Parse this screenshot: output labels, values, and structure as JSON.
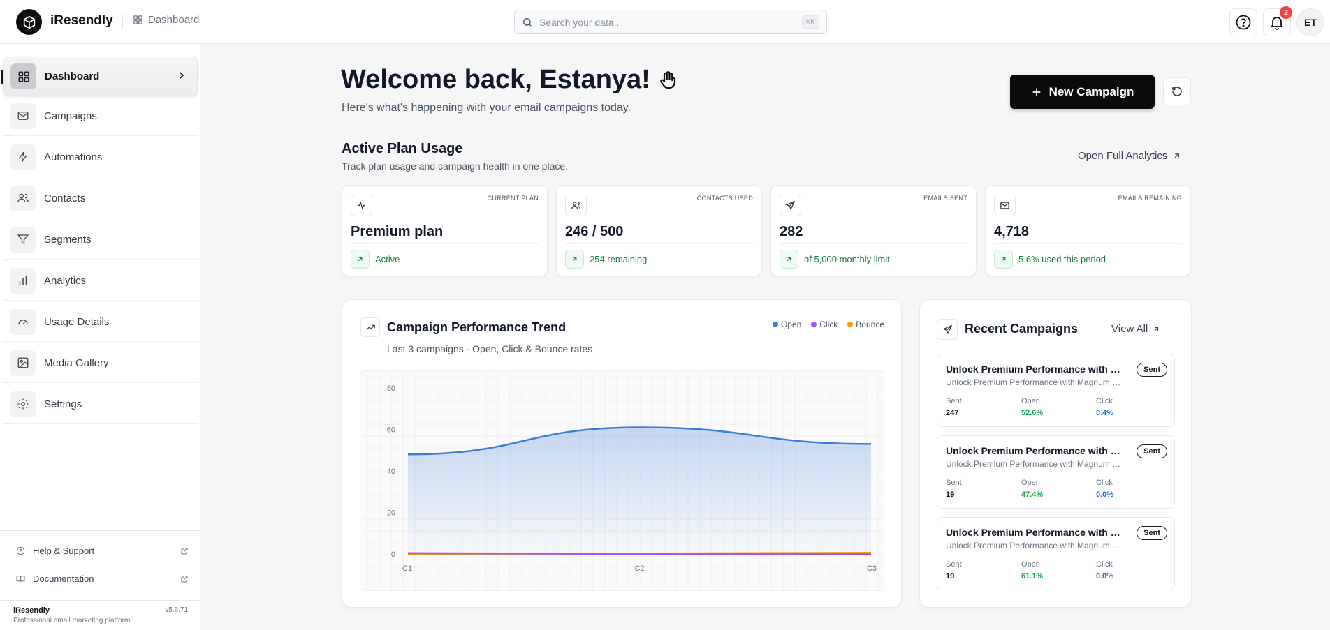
{
  "app": {
    "brand": "iResendly",
    "breadcrumb": "Dashboard",
    "search_placeholder": "Search your data..",
    "search_shortcut": "⌘K",
    "notifications_count": "2",
    "user_initials": "ET"
  },
  "sidebar": {
    "items": [
      {
        "label": "Dashboard",
        "icon": "dashboard-icon"
      },
      {
        "label": "Campaigns",
        "icon": "mail-icon"
      },
      {
        "label": "Automations",
        "icon": "bolt-icon"
      },
      {
        "label": "Contacts",
        "icon": "users-icon"
      },
      {
        "label": "Segments",
        "icon": "filter-icon"
      },
      {
        "label": "Analytics",
        "icon": "bar-chart-icon"
      },
      {
        "label": "Usage Details",
        "icon": "gauge-icon"
      },
      {
        "label": "Media Gallery",
        "icon": "image-icon"
      },
      {
        "label": "Settings",
        "icon": "gear-icon"
      }
    ],
    "footer_links": [
      {
        "label": "Help & Support",
        "icon": "help-icon"
      },
      {
        "label": "Documentation",
        "icon": "book-icon"
      }
    ],
    "app_name": "iResendly",
    "version": "v5.6.71",
    "tagline": "Professional email marketing platform"
  },
  "header": {
    "welcome": "Welcome back, Estanya!",
    "subtitle": "Here's what's happening with your email campaigns today.",
    "new_campaign": "New Campaign"
  },
  "plan": {
    "title": "Active Plan Usage",
    "subtitle": "Track plan usage and campaign health in one place.",
    "open_analytics": "Open Full Analytics",
    "cards": [
      {
        "label": "CURRENT PLAN",
        "value": "Premium plan",
        "foot": "Active",
        "icon": "activity-icon"
      },
      {
        "label": "CONTACTS USED",
        "value": "246 / 500",
        "foot": "254 remaining",
        "icon": "users-icon"
      },
      {
        "label": "EMAILS SENT",
        "value": "282",
        "foot": "of 5,000 monthly limit",
        "icon": "send-icon"
      },
      {
        "label": "EMAILS REMAINING",
        "value": "4,718",
        "foot": "5.6% used this period",
        "icon": "mail-icon"
      }
    ]
  },
  "trend": {
    "title": "Campaign Performance Trend",
    "subtitle": "Last 3 campaigns · Open, Click & Bounce rates",
    "legend": [
      "Open",
      "Click",
      "Bounce"
    ],
    "colors": {
      "open": "#3b7ddd",
      "click": "#a855f7",
      "bounce": "#f59e0b"
    }
  },
  "chart_data": {
    "type": "area",
    "categories": [
      "C1",
      "C2",
      "C3"
    ],
    "y_ticks": [
      "0",
      "20",
      "40",
      "60",
      "80"
    ],
    "ylim": [
      0,
      80
    ],
    "grid": true,
    "legend_position": "top-right",
    "series": [
      {
        "name": "Open",
        "values": [
          48,
          61,
          53
        ]
      },
      {
        "name": "Click",
        "values": [
          0.4,
          0.0,
          0.0
        ]
      },
      {
        "name": "Bounce",
        "values": [
          0,
          0.2,
          0.6
        ]
      }
    ]
  },
  "recent": {
    "title": "Recent Campaigns",
    "view_all": "View All",
    "campaigns": [
      {
        "title": "Unlock Premium Performance with Magnum Pro",
        "subtitle": "Unlock Premium Performance with Magnum Pro",
        "status": "Sent",
        "sent_label": "Sent",
        "sent": "247",
        "open_label": "Open",
        "open": "52.6%",
        "click_label": "Click",
        "click": "0.4%"
      },
      {
        "title": "Unlock Premium Performance with Magnum Pro",
        "subtitle": "Unlock Premium Performance with Magnum Pro",
        "status": "Sent",
        "sent_label": "Sent",
        "sent": "19",
        "open_label": "Open",
        "open": "47.4%",
        "click_label": "Click",
        "click": "0.0%"
      },
      {
        "title": "Unlock Premium Performance with Magnum Pro",
        "subtitle": "Unlock Premium Performance with Magnum Pro",
        "status": "Sent",
        "sent_label": "Sent",
        "sent": "19",
        "open_label": "Open",
        "open": "61.1%",
        "click_label": "Click",
        "click": "0.0%"
      }
    ]
  }
}
